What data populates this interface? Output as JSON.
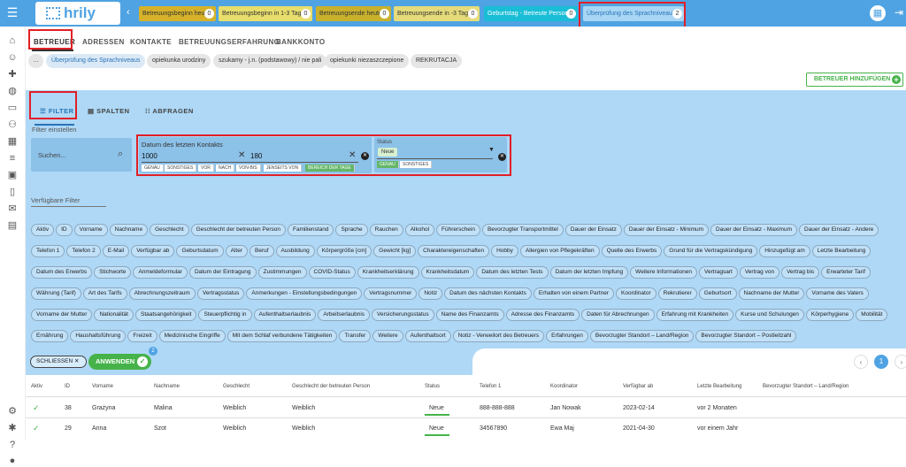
{
  "app": {
    "logo": "hrily"
  },
  "filter_tabs": [
    {
      "label": "Betreuungsbeginn heute",
      "count": "0"
    },
    {
      "label": "Betreuungsbeginn in 1-3 Tagen",
      "count": "0"
    },
    {
      "label": "Betreuungsende heute",
      "count": "0"
    },
    {
      "label": "Betreuungsende in -3 Tagen",
      "count": "0"
    },
    {
      "label": "Geburtstag - Betreute Person",
      "count": "0"
    },
    {
      "label": "Überprüfung des Sprachniveaus",
      "count": "2"
    }
  ],
  "nav_tabs": [
    "BETREUER",
    "ADRESSEN",
    "KONTAKTE",
    "BETREUUNGSERFAHRUNG",
    "BANKKONTO"
  ],
  "saved_chips": [
    "...",
    "Überprüfung des Sprachniveaus",
    "opiekunka urodziny",
    "szukamy - j.n. (podstawowy) / nie pali",
    "opiekunki niezaszczepione",
    "REKRUTACJA"
  ],
  "add_button": "BETREUER HINZUFÜGEN",
  "toolbar": {
    "filter": "FILTER",
    "columns": "SPALTEN",
    "queries": "ABFRAGEN"
  },
  "filter_settings_label": "Filter einstellen",
  "search": {
    "placeholder": "Suchen..."
  },
  "date_filter": {
    "title": "Datum des letzten Kontakts",
    "from": "1000",
    "to": "180",
    "modes": [
      "GENAU",
      "SONSTIGES",
      "VOR",
      "NACH",
      "VON-BIS",
      "JENSEITS VON",
      "BEREICH DER TAGE"
    ],
    "active_mode": "BEREICH DER TAGE"
  },
  "status_filter": {
    "title": "Status",
    "value": "Neue",
    "modes": [
      "GENAU",
      "SONSTIGES"
    ],
    "active_mode": "GENAU"
  },
  "available_filters_label": "Verfügbare Filter",
  "available_filters": [
    "Aktiv",
    "ID",
    "Vorname",
    "Nachname",
    "Geschlecht",
    "Geschlecht der betreuten Person",
    "Familienstand",
    "Sprache",
    "Rauchen",
    "Alkohol",
    "Führerschein",
    "Bevorzugter Transportmittel",
    "Dauer der Einsatz",
    "Dauer der Einsatz - Minimum",
    "Dauer der Einsatz - Maximum",
    "Dauer der Einsatz - Andere",
    "Telefon 1",
    "Telefon 2",
    "E-Mail",
    "Verfügbar ab",
    "Geburtsdatum",
    "Alter",
    "Beruf",
    "Ausbildung",
    "Körpergröße [cm]",
    "Gewicht [kg]",
    "Charaktereigenschaften",
    "Hobby",
    "Allergien von Pflegekräften",
    "Quelle des Erwerbs",
    "Grund für die Vertragskündigung",
    "Hinzugefügt am",
    "Letzte Bearbeitung",
    "Datum des Erwerbs",
    "Stichworte",
    "Anmeldeformular",
    "Datum der Eintragung",
    "Zustimmungen",
    "COVID-Status",
    "Krankheitserklärung",
    "Krankheitsdatum",
    "Datum des letzten Tests",
    "Datum der letzten Impfung",
    "Weitere Informationen",
    "Vertragsart",
    "Vertrag von",
    "Vertrag bis",
    "Erwarteter Tarif",
    "Währung (Tarif)",
    "Art des Tarifs",
    "Abrechnungszeitraum",
    "Vertragsstatus",
    "Anmerkungen - Einstellungsbedingungen",
    "Vertragsnummer",
    "Notiz",
    "Datum des nächsten Kontakts",
    "Erhalten von einem Partner",
    "Koordinator",
    "Rekrutierer",
    "Geburtsort",
    "Nachname der Mutter",
    "Vorname des Vaters",
    "Vorname der Mutter",
    "Nationalität",
    "Staatsangehörigkeit",
    "Steuerpflichtig in",
    "Aufenthaltserlaubnis",
    "Arbeitserlaubnis",
    "Versicherungsstatus",
    "Name des Finanzamts",
    "Adresse des Finanzamts",
    "Daten für Abrechnungen",
    "Erfahrung mit Krankheiten",
    "Kurse und Schulungen",
    "Körperhygiene",
    "Mobilität",
    "Ernährung",
    "Haushaltsführung",
    "Freizeit",
    "Medizinische Eingriffe",
    "Mit dem Schlaf verbundene Tätigkeiten",
    "Transfer",
    "Weitere",
    "Aufenthaltsort",
    "Notiz - Verweilort des Betreuers",
    "Erfahrungen",
    "Bevorzugter Standort – Land/Region",
    "Bevorzugter Standort – Postleitzahl"
  ],
  "actions": {
    "close": "SCHLIESSEN",
    "apply": "ANWENDEN",
    "apply_badge": "2"
  },
  "pagination": {
    "current": "1"
  },
  "table": {
    "headers": [
      "Aktiv",
      "ID",
      "Vorname",
      "Nachname",
      "Geschlecht",
      "Geschlecht der betreuten Person",
      "Status",
      "Telefon 1",
      "Koordinator",
      "Verfügbar ab",
      "Letzte Bearbeitung",
      "Bevorzugter Standort – Land/Region"
    ],
    "rows": [
      {
        "aktiv": "✓",
        "id": "38",
        "vorname": "Grażyna",
        "nachname": "Malina",
        "geschlecht": "Weiblich",
        "geschlecht_betreut": "Weiblich",
        "status": "Neue",
        "telefon": "888-888-888",
        "koordinator": "Jan Nowak",
        "verfuegbar": "2023-02-14",
        "bearbeitung": "vor 2 Monaten"
      },
      {
        "aktiv": "✓",
        "id": "29",
        "vorname": "Anna",
        "nachname": "Szot",
        "geschlecht": "Weiblich",
        "geschlecht_betreut": "Weiblich",
        "status": "Neue",
        "telefon": "34567890",
        "koordinator": "Ewa Maj",
        "verfuegbar": "2021-04-30",
        "bearbeitung": "vor einem Jahr"
      }
    ]
  },
  "colors": {
    "primary": "#4fa3e3",
    "panel": "#aed8f6",
    "success": "#46b34a",
    "highlight": "#e21f27"
  }
}
